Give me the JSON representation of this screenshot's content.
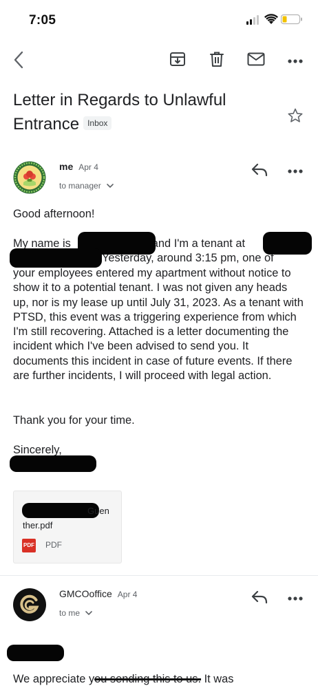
{
  "status_bar": {
    "time": "7:05"
  },
  "toolbar": {
    "back_icon": "chevron-left-icon",
    "archive_icon": "archive-icon",
    "delete_icon": "trash-icon",
    "mail_icon": "mail-icon",
    "more_icon": "more-horizontal-icon"
  },
  "subject": {
    "text": "Letter in Regards to Unlawful Entrance",
    "label": "Inbox"
  },
  "message1": {
    "sender": "me",
    "date": "Apr 4",
    "recipients": "to manager",
    "greeting": "Good afternoon!",
    "para1_line1_a": "My name is",
    "para1_line1_b": "and I'm a tenant at",
    "para1_line2": "Yesterday, around 3:15 pm, one of",
    "para1_rest": "your employees entered my apartment without notice to show it to a potential tenant. I was not given any heads up, nor is my lease up until July 31, 2023. As a tenant with PTSD, this event was a triggering experience from which I'm still recovering. Attached is a letter documenting the incident which I've been advised to send you. It documents this incident in case of future events. If there are further incidents, I will proceed with legal action.",
    "thanks": "Thank you for your time.",
    "signoff": "Sincerely,",
    "attachment": {
      "name_part1": "Guen",
      "name_part2": "ther.pdf",
      "type_badge": "PDF",
      "type_label": "PDF"
    }
  },
  "message2": {
    "sender": "GMCOoffice",
    "date": "Apr 4",
    "recipients": "to me",
    "body_start": "We appreciate y",
    "body_strike": "ou sending this to us.",
    "body_end": " It was"
  },
  "colors": {
    "text": "#202124",
    "secondary": "#5f6368",
    "pdf_red": "#d93025",
    "star": "#5f6368"
  }
}
